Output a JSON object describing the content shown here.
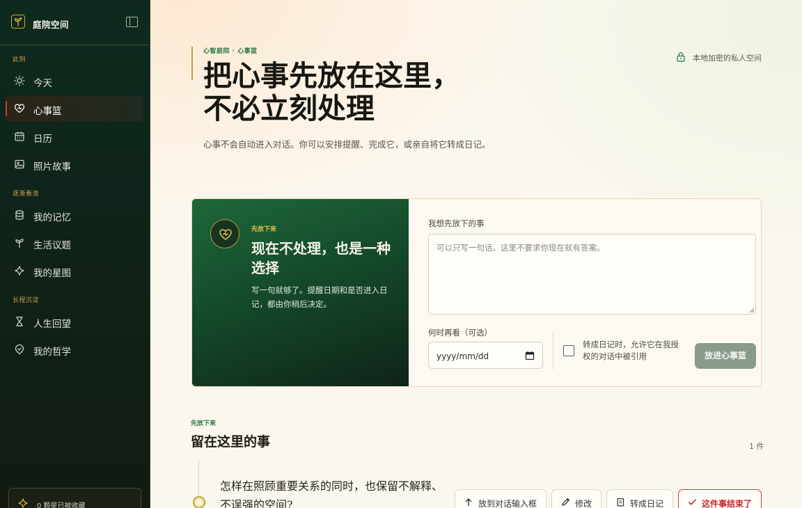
{
  "sidebar": {
    "brand_name": "庭院空间",
    "sections": [
      {
        "title": "此刻"
      },
      {
        "title": "逐渐看清"
      },
      {
        "title": "长程沉淀"
      }
    ],
    "items": [
      {
        "label": "今天",
        "icon": "sun-icon"
      },
      {
        "label": "心事篮",
        "icon": "heart-basket-icon",
        "active": true
      },
      {
        "label": "日历",
        "icon": "calendar-icon"
      },
      {
        "label": "照片故事",
        "icon": "image-icon"
      },
      {
        "label": "我的记忆",
        "icon": "database-icon"
      },
      {
        "label": "生活议题",
        "icon": "sprout-icon"
      },
      {
        "label": "我的星图",
        "icon": "sparkle-icon"
      },
      {
        "label": "人生回望",
        "icon": "hourglass-icon"
      },
      {
        "label": "我的哲学",
        "icon": "badge-check-icon"
      }
    ],
    "favorites_text": "0 颗星已被收藏"
  },
  "header": {
    "eyebrow": "心智庭院 · 心事篮",
    "title": "把心事先放在这里，不必立刻处理",
    "subtitle": "心事不会自动进入对话。你可以安排提醒、完成它，或亲自将它转成日记。",
    "private_badge": "本地加密的私人空间"
  },
  "composer": {
    "eyebrow": "先放下来",
    "title": "现在不处理，也是一种选择",
    "description": "写一句就够了。提醒日期和是否进入日记，都由你稍后决定。",
    "input_label": "我想先放下的事",
    "input_placeholder": "可以只写一句话。这里不要求你现在就有答案。",
    "date_label": "何时再看（可选）",
    "date_placeholder": "yyyy/mm/dd",
    "checkbox_label": "转成日记时，允许它在我授权的对话中被引用",
    "submit_label": "放进心事篮"
  },
  "list": {
    "eyebrow": "先放下来",
    "title": "留在这里的事",
    "count": "1 件",
    "items": [
      {
        "text": "怎样在照顾重要关系的同时，也保留不解释、不逞强的空间?",
        "actions": {
          "send": "放到对话输入框",
          "edit": "修改",
          "journal": "转成日记",
          "done": "这件事结束了"
        }
      }
    ]
  },
  "colors": {
    "accent_green": "#1e6838",
    "accent_gold": "#c9a13a",
    "danger": "#d23a3a"
  }
}
